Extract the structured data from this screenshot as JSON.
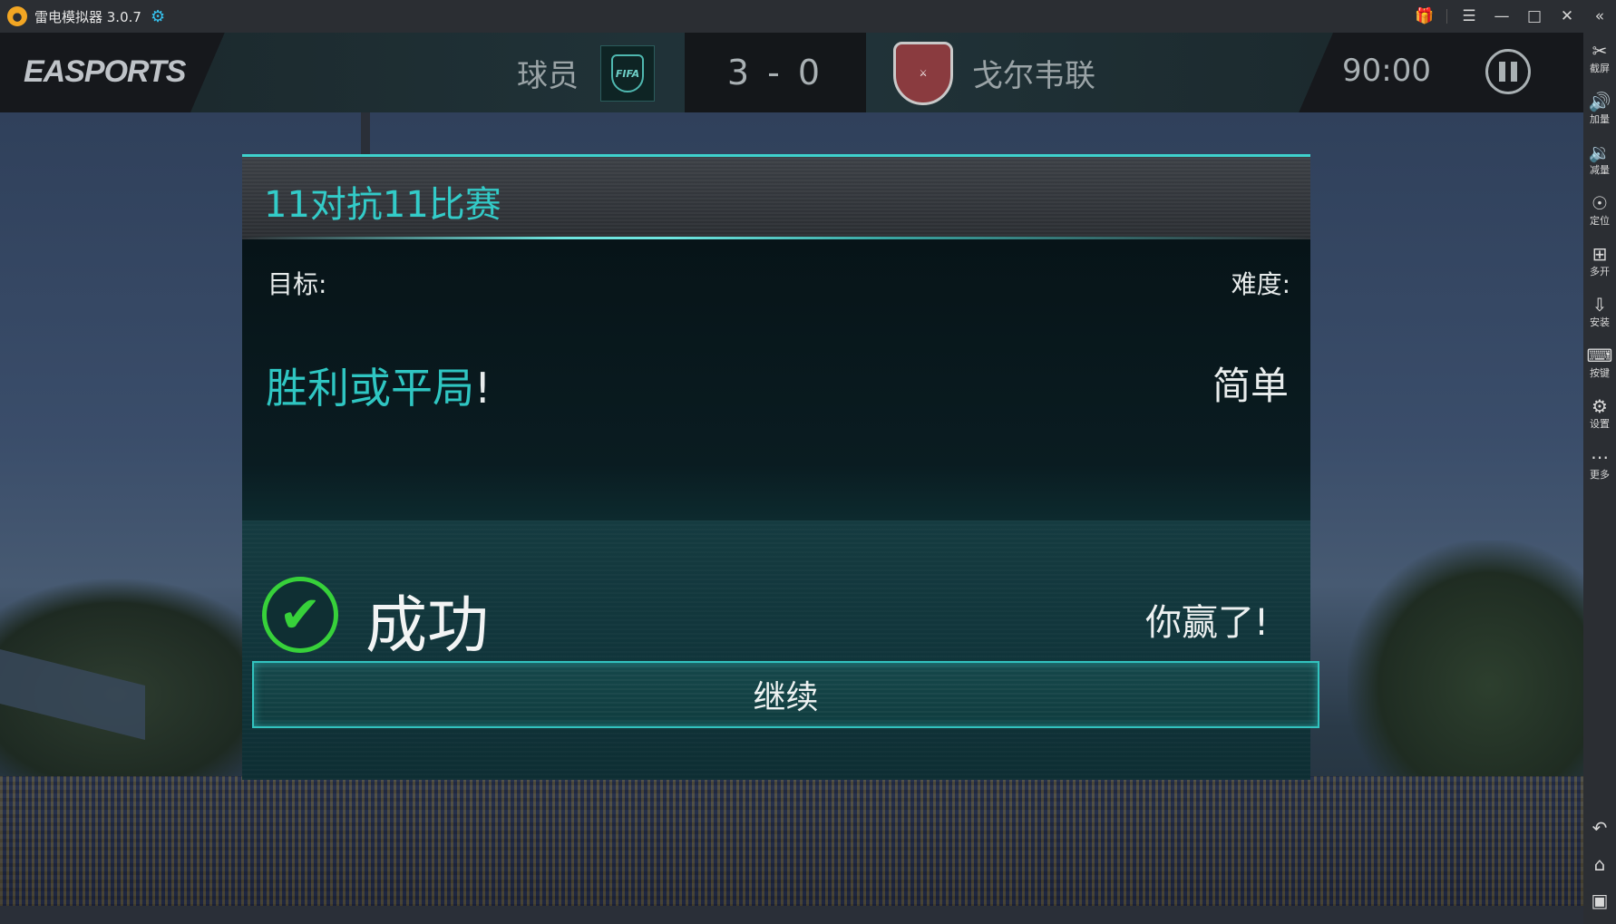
{
  "window": {
    "title": "雷电模拟器 3.0.7",
    "icons": [
      "emulator-logo-icon",
      "gamepad-icon",
      "gift-icon",
      "menu-icon",
      "minimize-icon",
      "maximize-icon",
      "close-icon",
      "collapse-icon"
    ]
  },
  "sidebar": {
    "tools": [
      {
        "icon": "scissors-icon",
        "label": "截屏"
      },
      {
        "icon": "volume-up-icon",
        "label": "加量"
      },
      {
        "icon": "volume-down-icon",
        "label": "减量"
      },
      {
        "icon": "location-icon",
        "label": "定位"
      },
      {
        "icon": "multi-open-icon",
        "label": "多开"
      },
      {
        "icon": "apk-install-icon",
        "label": "安装"
      },
      {
        "icon": "keyboard-icon",
        "label": "按键"
      },
      {
        "icon": "settings-icon",
        "label": "设置"
      },
      {
        "icon": "more-icon",
        "label": "更多"
      }
    ],
    "bottom": [
      "back-icon",
      "home-icon",
      "recents-icon"
    ]
  },
  "hud": {
    "brand": "EASPORTS",
    "home_team": "球员",
    "home_badge_text": "FIFA",
    "score": "3 - 0",
    "away_team": "戈尔韦联",
    "clock": "90:00"
  },
  "dialog": {
    "title": "11对抗11比赛",
    "goal_label": "目标:",
    "difficulty_label": "难度:",
    "goal_value": "胜利或平局",
    "goal_value_punct": "!",
    "difficulty_value": "简单",
    "result_status": "成功",
    "result_message": "你赢了!",
    "continue_label": "继续"
  },
  "colors": {
    "accent": "#33cbc8",
    "success": "#37d13a",
    "chrome": "#2b2e33"
  }
}
